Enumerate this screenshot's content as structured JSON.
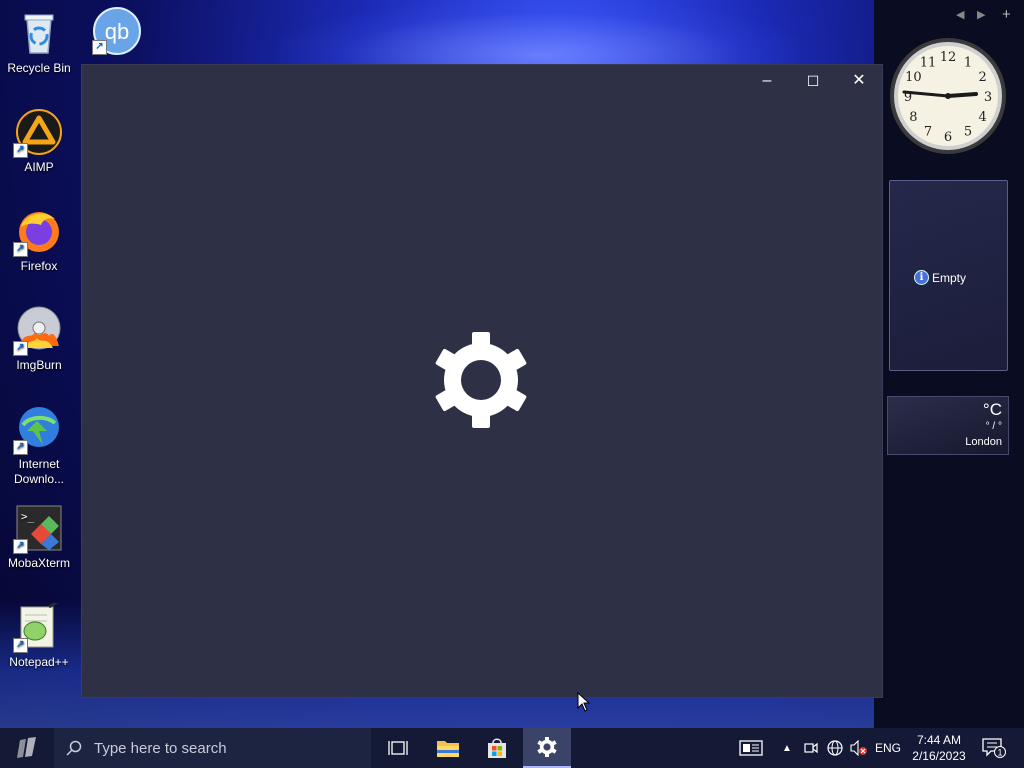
{
  "desktop": {
    "icons": [
      {
        "label": "Recycle Bin",
        "icon": "recycle-bin-icon"
      },
      {
        "label": "AIMP",
        "icon": "aimp-icon"
      },
      {
        "label": "Firefox",
        "icon": "firefox-icon"
      },
      {
        "label": "ImgBurn",
        "icon": "imgburn-icon"
      },
      {
        "label": "Internet Downlo...",
        "icon": "internet-download-manager-icon"
      },
      {
        "label": "MobaXterm",
        "icon": "mobaxterm-icon"
      },
      {
        "label": "Notepad++",
        "icon": "notepad-plus-plus-icon"
      }
    ],
    "second_column_icon": {
      "label": "qBittorrent",
      "glyph": "qb"
    }
  },
  "settings_window": {
    "minimize": "–",
    "maximize": "☐",
    "close": "✕",
    "splash_icon": "gear-icon",
    "background": "#2e3046"
  },
  "gadgets": {
    "clock_numbers": [
      "12",
      "1",
      "2",
      "3",
      "4",
      "5",
      "6",
      "7",
      "8",
      "9",
      "10",
      "11"
    ],
    "empty_gadget": {
      "label": "Empty"
    },
    "weather": {
      "temp": "°C",
      "range": "° / °",
      "city": "London"
    },
    "nav": {
      "prev": "◀",
      "next": "▶",
      "add": "+"
    }
  },
  "taskbar": {
    "search_placeholder": "Type here to search",
    "language": "ENG",
    "time": "7:44 AM",
    "date": "2/16/2023",
    "notification_count": "1"
  }
}
